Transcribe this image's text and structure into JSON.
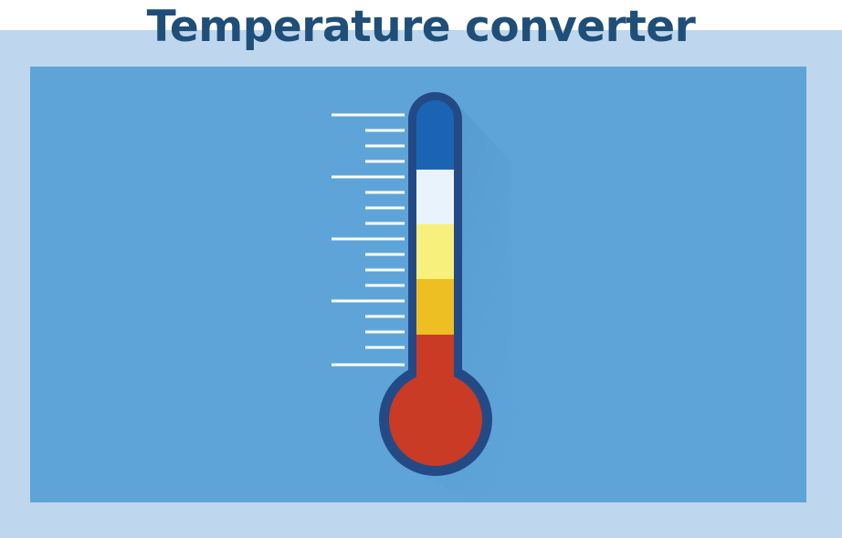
{
  "title": "Temperature converter",
  "colors": {
    "title": "#1f4e79",
    "frame": "#bed7ee",
    "panel": "#5ea4d8",
    "thermometer_outline": "#244a86",
    "band_cold": "#1b64b3",
    "band_cool": "#e8f3fb",
    "band_mild": "#f8f07c",
    "band_warm": "#eebf22",
    "band_hot": "#c93b25",
    "scale_ticks": "#ffffff"
  },
  "thermometer": {
    "icon": "thermometer-icon",
    "scale": {
      "major_ticks": 5,
      "minor_ticks_between_major": 3
    }
  }
}
